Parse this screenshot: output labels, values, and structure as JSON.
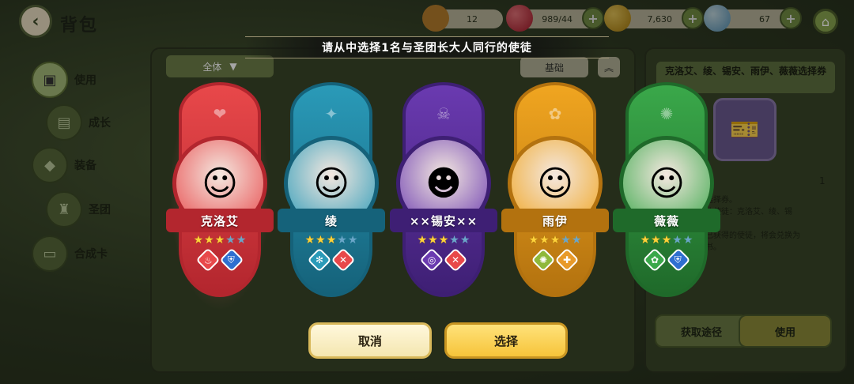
{
  "header": {
    "back_icon": "chevron-left-icon",
    "title": "背包"
  },
  "resources": [
    {
      "name": "bread",
      "value": "12",
      "color": "#c9862e"
    },
    {
      "name": "gem",
      "value": "989/44",
      "color": "#d02a3a"
    },
    {
      "name": "coin",
      "value": "7,630",
      "color": "#d4a019"
    },
    {
      "name": "bird",
      "value": "67",
      "color": "#7ab6d8"
    }
  ],
  "sidebar": {
    "items": [
      {
        "label": "使用",
        "icon": "bag-icon"
      },
      {
        "label": "成长",
        "icon": "book-icon"
      },
      {
        "label": "装备",
        "icon": "equipment-icon"
      },
      {
        "label": "圣团",
        "icon": "castle-icon"
      },
      {
        "label": "合成卡",
        "icon": "card-icon"
      }
    ]
  },
  "inventory": {
    "filter_label": "全体",
    "sort_label": "基础",
    "detail_title": "克洛艾、绫、锡安、雨伊、薇薇选择券",
    "count": "1",
    "description": "…徒选择券。\n…艾达使徒：克洛艾、绫、锡\n…薇薇\n…了已获得的使徒，将会兑换为\n…证书。",
    "obtain_label": "获取途径",
    "use_label": "使用"
  },
  "dialog": {
    "title": "请从中选择1名与圣团长大人同行的使徒",
    "cancel_label": "取消",
    "select_label": "选择",
    "characters": [
      {
        "name": "克洛艾",
        "stars": 3,
        "max_stars": 5,
        "theme": "#e8484a",
        "dark": "#b3262e",
        "badges": [
          "fire-icon",
          "shield-icon"
        ],
        "badge_colors": [
          "#e8484a",
          "#2f6fd0"
        ]
      },
      {
        "name": "绫",
        "stars": 3,
        "max_stars": 5,
        "theme": "#2a9ab8",
        "dark": "#15627a",
        "badges": [
          "snowflake-icon",
          "swords-icon"
        ],
        "badge_colors": [
          "#2a9ab8",
          "#e8484a"
        ]
      },
      {
        "name": "××锡安××",
        "stars": 3,
        "max_stars": 5,
        "theme": "#6a3ab0",
        "dark": "#3e1f74",
        "badges": [
          "vortex-icon",
          "swords-icon"
        ],
        "badge_colors": [
          "#6a3ab0",
          "#e8484a"
        ]
      },
      {
        "name": "雨伊",
        "stars": 3,
        "max_stars": 5,
        "theme": "#f0a520",
        "dark": "#b3720f",
        "badges": [
          "sun-icon",
          "cross-icon"
        ],
        "badge_colors": [
          "#8fb83a",
          "#e89a2a"
        ]
      },
      {
        "name": "薇薇",
        "stars": 3,
        "max_stars": 5,
        "theme": "#3aa84a",
        "dark": "#1f6a2a",
        "badges": [
          "flower-icon",
          "shield-icon"
        ],
        "badge_colors": [
          "#3aa84a",
          "#2f6fd0"
        ]
      }
    ]
  }
}
